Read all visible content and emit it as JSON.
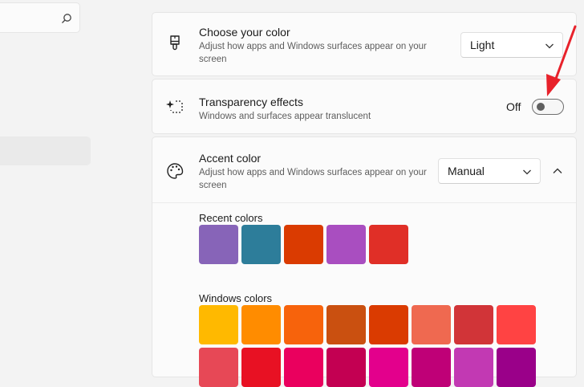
{
  "choose_color": {
    "title": "Choose your color",
    "description": "Adjust how apps and Windows surfaces appear on your screen",
    "selected": "Light",
    "icon": "paintbrush-icon"
  },
  "transparency": {
    "title": "Transparency effects",
    "description": "Windows and surfaces appear translucent",
    "state_label": "Off",
    "toggle_on": false,
    "icon": "transparency-sparkle-icon"
  },
  "accent": {
    "title": "Accent color",
    "description": "Adjust how apps and Windows surfaces appear on your screen",
    "selected": "Manual",
    "icon": "palette-icon",
    "recent_label": "Recent colors",
    "recent_colors": [
      "#8764b8",
      "#2d7d9a",
      "#da3b01",
      "#a94ec0",
      "#e02f27"
    ],
    "windows_label": "Windows colors",
    "windows_colors_row1": [
      "#ffb900",
      "#ff8c00",
      "#f7630c",
      "#ca5010",
      "#da3b01",
      "#ef6950",
      "#d13438",
      "#ff4343"
    ],
    "windows_colors_row2": [
      "#e74856",
      "#e81123",
      "#ea005e",
      "#c30052",
      "#e3008c",
      "#bf0077",
      "#c239b3",
      "#9a0089"
    ]
  },
  "annotation_color": "#e8222b"
}
